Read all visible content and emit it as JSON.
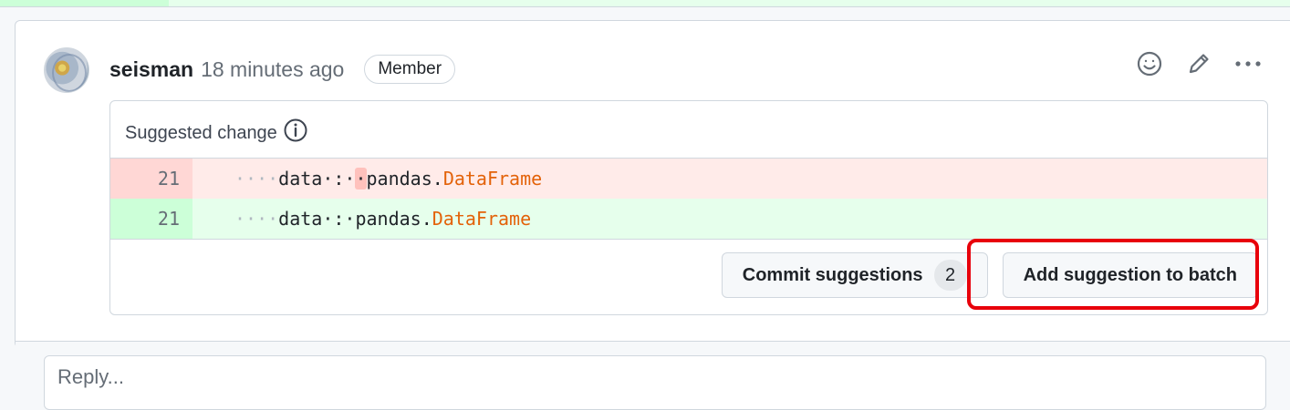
{
  "comment": {
    "author": "seisman",
    "timestamp": "18 minutes ago",
    "role": "Member"
  },
  "header_actions": {
    "icons": [
      "smiley-icon",
      "pencil-icon",
      "kebab-menu-icon"
    ]
  },
  "suggestion": {
    "title": "Suggested change",
    "diff": {
      "removed": {
        "line_number": "21",
        "indent": "····",
        "name": "data",
        "sep_before": "·:·",
        "extra_space": "·",
        "module": "pandas.",
        "type": "DataFrame"
      },
      "added": {
        "line_number": "21",
        "indent": "····",
        "name": "data",
        "sep": "·:·",
        "module": "pandas.",
        "type": "DataFrame"
      }
    },
    "commit_button_label": "Commit suggestions",
    "commit_count": "2",
    "add_to_batch_label": "Add suggestion to batch"
  },
  "reply": {
    "placeholder": "Reply..."
  },
  "colors": {
    "highlight_ring": "#e8000b",
    "deleted_bg": "#ffebe9",
    "added_bg": "#e6ffec",
    "type_name": "#e36209"
  }
}
